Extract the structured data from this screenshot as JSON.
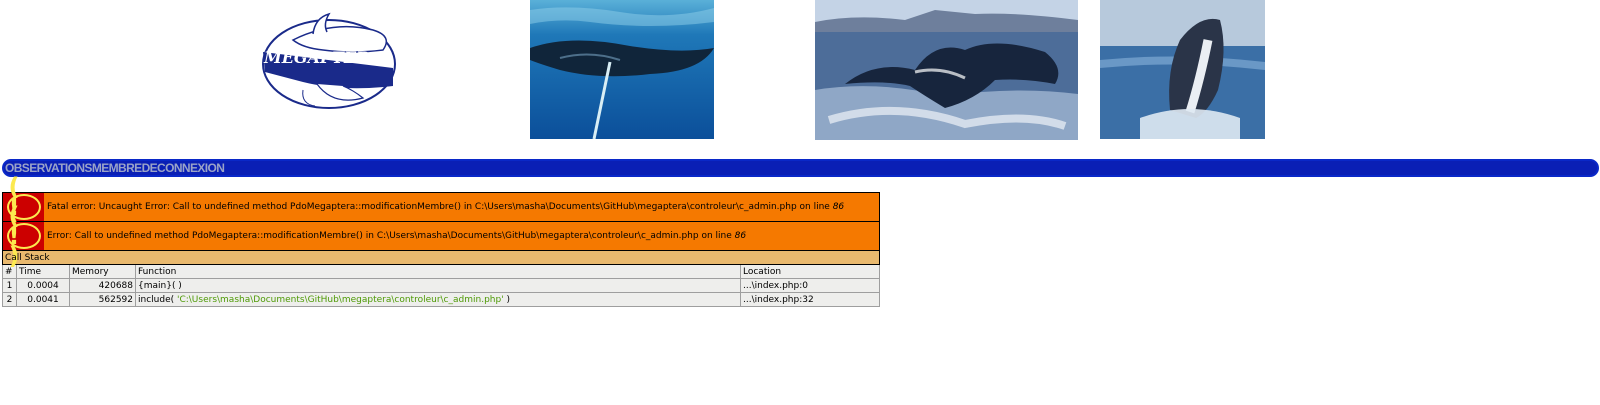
{
  "logo": {
    "text": "MEGAPTERA"
  },
  "nav": {
    "items": [
      "OBSERVATIONS",
      "MEMBRE",
      "DECONNEXION"
    ]
  },
  "error": {
    "icon_glyph": "( ! )",
    "fatal_prefix": "Fatal error: Uncaught Error: Call to undefined method PdoMegaptera::modificationMembre() in C:\\Users\\masha\\Documents\\GitHub\\megaptera\\controleur\\c_admin.php on line ",
    "fatal_line": "86",
    "error_prefix": "Error: Call to undefined method PdoMegaptera::modificationMembre() in C:\\Users\\masha\\Documents\\GitHub\\megaptera\\controleur\\c_admin.php on line ",
    "error_line": "86",
    "callstack_title": "Call Stack",
    "columns": [
      "#",
      "Time",
      "Memory",
      "Function",
      "Location"
    ],
    "rows": [
      {
        "n": "1",
        "time": "0.0004",
        "memory": "420688",
        "func": "{main}( )",
        "func_arg": "",
        "func_end": "",
        "location": "...\\index.php:0"
      },
      {
        "n": "2",
        "time": "0.0041",
        "memory": "562592",
        "func": "include( ",
        "func_arg": "'C:\\Users\\masha\\Documents\\GitHub\\megaptera\\controleur\\c_admin.php'",
        "func_end": " )",
        "location": "...\\index.php:32"
      }
    ]
  },
  "colors": {
    "nav_bg": "#0a1fb5",
    "error_bg": "#f57900",
    "callstack_bg": "#e9b96e",
    "row_bg": "#eeeeec",
    "icon_bg": "#cc0000",
    "icon_fg": "#fce94f",
    "arg_green": "#4e9a06"
  }
}
